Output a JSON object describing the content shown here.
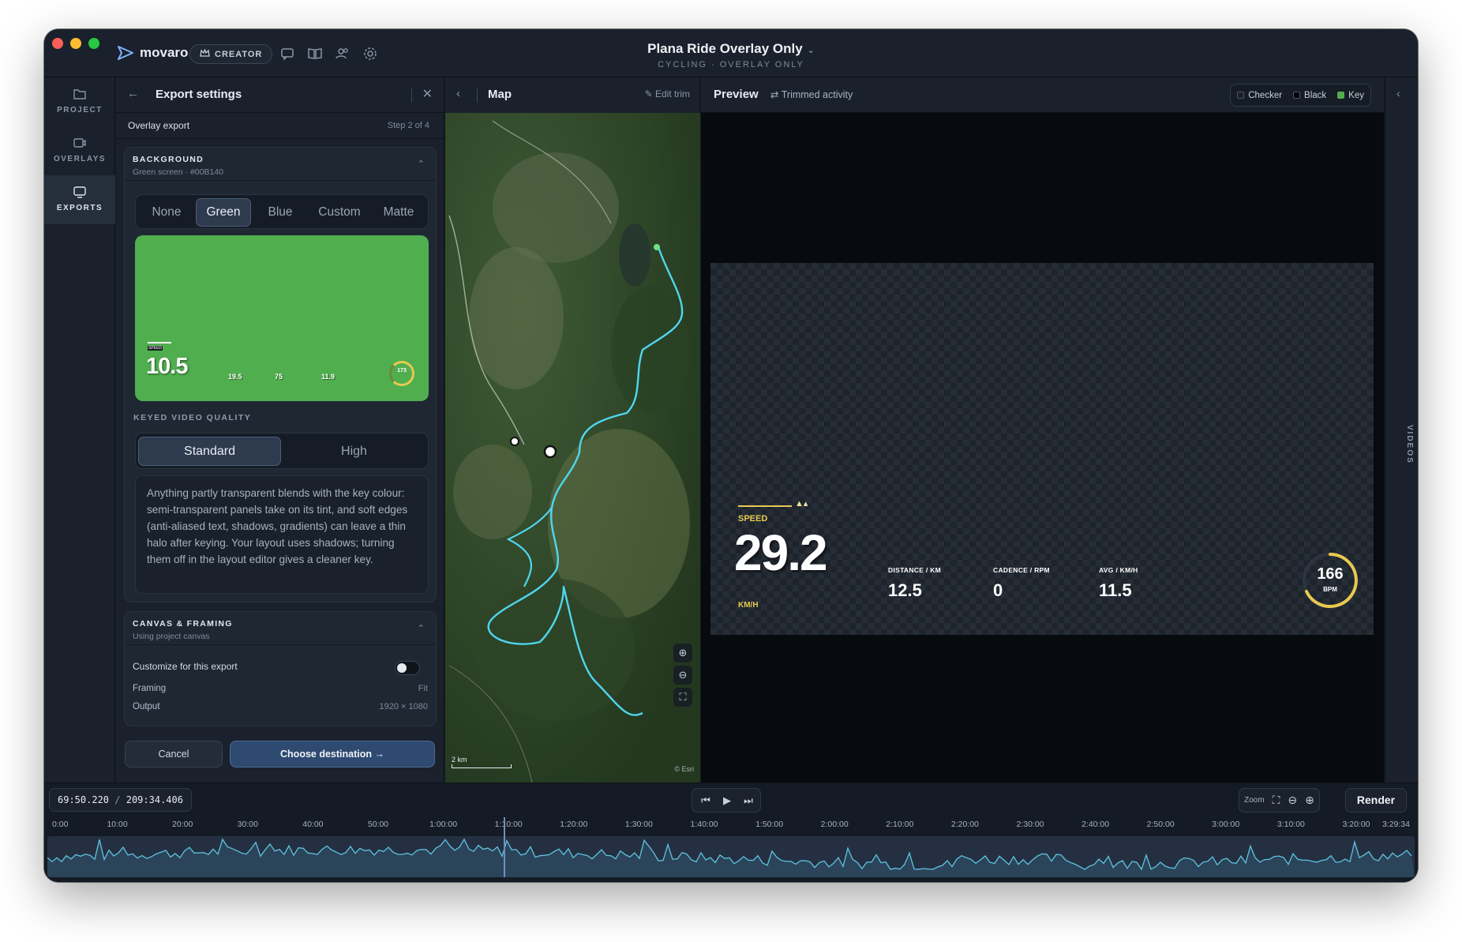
{
  "window": {
    "app_name": "movaro",
    "badge": "CREATOR",
    "title": "Plana Ride Overlay Only",
    "subtitle": "CYCLING · OVERLAY ONLY"
  },
  "rail": [
    {
      "label": "PROJECT",
      "icon": "folder-icon"
    },
    {
      "label": "OVERLAYS",
      "icon": "video-icon"
    },
    {
      "label": "EXPORTS",
      "icon": "export-icon"
    }
  ],
  "export": {
    "title": "Export settings",
    "section": "Overlay export",
    "step": "Step 2 of 4",
    "background": {
      "heading": "BACKGROUND",
      "subtitle": "Green screen · #00B140",
      "options": [
        "None",
        "Green",
        "Blue",
        "Custom",
        "Matte"
      ],
      "selected": "Green",
      "swatch_color": "#50AE4F"
    },
    "mini_preview": {
      "speed_label": "SPEED",
      "speed": "10.5",
      "stats": [
        "19.5",
        "75",
        "11.9"
      ],
      "heart": "173"
    },
    "quality": {
      "heading": "KEYED VIDEO QUALITY",
      "options": [
        "Standard",
        "High"
      ],
      "selected": "Standard"
    },
    "note": "Anything partly transparent blends with the key colour: semi-transparent panels take on its tint, and soft edges (anti-aliased text, shadows, gradients) can leave a thin halo after keying. Your layout uses shadows; turning them off in the layout editor gives a cleaner key.",
    "canvas": {
      "heading": "CANVAS & FRAMING",
      "subtitle": "Using project canvas",
      "customize_label": "Customize for this export",
      "customize_on": false,
      "framing_label": "Framing",
      "framing_value": "Fit",
      "output_label": "Output",
      "output_value": "1920 × 1080"
    },
    "cancel": "Cancel",
    "choose": "Choose destination →"
  },
  "map": {
    "title": "Map",
    "edit_trim": "Edit trim",
    "scale": "2 km",
    "attribution": "© Esri"
  },
  "preview": {
    "title": "Preview",
    "trimmed": "Trimmed activity",
    "bg_options": [
      {
        "label": "Checker",
        "color": "#1a1f26"
      },
      {
        "label": "Black",
        "color": "#000000"
      },
      {
        "label": "Key",
        "color": "#50AE4F"
      }
    ],
    "overlay": {
      "speed_label": "SPEED",
      "speed": "29.2",
      "unit": "KM/H",
      "stats": [
        {
          "label": "DISTANCE / KM",
          "value": "12.5"
        },
        {
          "label": "CADENCE / RPM",
          "value": "0"
        },
        {
          "label": "AVG / KM/H",
          "value": "11.5"
        }
      ],
      "heart": "166",
      "heart_unit": "BPM",
      "accent": "#E8C850"
    }
  },
  "right_rail": {
    "label": "VIDEOS"
  },
  "timeline": {
    "current": "69:50.220",
    "total": "209:34.406",
    "zoom_label": "Zoom",
    "render": "Render",
    "ticks": [
      "0:00",
      "10:00",
      "20:00",
      "30:00",
      "40:00",
      "50:00",
      "1:00:00",
      "1:10:00",
      "1:20:00",
      "1:30:00",
      "1:40:00",
      "1:50:00",
      "2:00:00",
      "2:10:00",
      "2:20:00",
      "2:30:00",
      "2:40:00",
      "2:50:00",
      "3:00:00",
      "3:10:00",
      "3:20:00",
      "3:29:34"
    ]
  }
}
